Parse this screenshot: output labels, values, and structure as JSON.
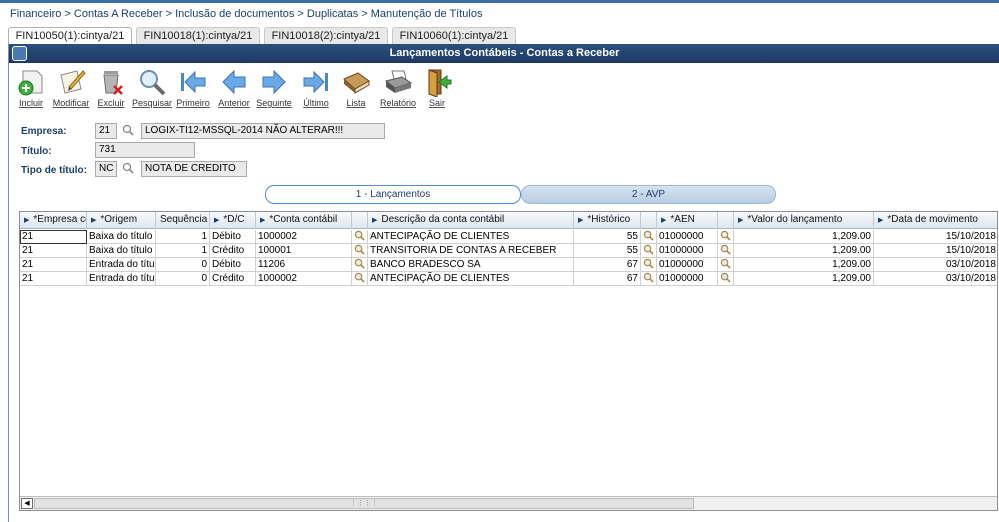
{
  "breadcrumb": "Financeiro > Contas A Receber > Inclusão de documentos > Duplicatas > Manutenção de Títulos",
  "tabs": [
    {
      "label": "FIN10050(1):cintya/21",
      "active": true
    },
    {
      "label": "FIN10018(1):cintya/21",
      "active": false
    },
    {
      "label": "FIN10018(2):cintya/21",
      "active": false
    },
    {
      "label": "FIN10060(1):cintya/21",
      "active": false
    }
  ],
  "window": {
    "title": "Lançamentos Contábeis - Contas a Receber"
  },
  "toolbar": {
    "incluir": "Incluir",
    "modificar": "Modificar",
    "excluir": "Excluir",
    "pesquisar": "Pesquisar",
    "primeiro": "Primeiro",
    "anterior": "Anterior",
    "seguinte": "Seguinte",
    "ultimo": "Último",
    "lista": "Lista",
    "relatorio": "Relatório",
    "sair": "Sair"
  },
  "form": {
    "empresa": {
      "label": "Empresa:",
      "code": "21",
      "description": "LOGIX-TI12-MSSQL-2014 NÃO ALTERAR!!!"
    },
    "titulo": {
      "label": "Título:",
      "value": "731"
    },
    "tipo_titulo": {
      "label": "Tipo de título:",
      "code": "NC",
      "description": "NOTA DE CREDITO"
    }
  },
  "subtabs": [
    {
      "label": "1 - Lançamentos",
      "active": true
    },
    {
      "label": "2 - AVP",
      "active": false
    }
  ],
  "grid": {
    "columns": [
      "*Empresa con",
      "*Origem",
      "Sequência",
      "*D/C",
      "*Conta contábil",
      "",
      "Descrição da conta contábil",
      "*Histórico",
      "",
      "*AEN",
      "",
      "*Valor do lançamento",
      "*Data de movimento"
    ],
    "rows": [
      {
        "empresa": "21",
        "origem": "Baixa do título",
        "sequencia": "1",
        "dc": "Débito",
        "conta": "1000002",
        "descricao": "ANTECIPAÇÃO DE CLIENTES",
        "historico": "55",
        "aen": "01000000",
        "valor": "1,209.00",
        "data": "15/10/2018"
      },
      {
        "empresa": "21",
        "origem": "Baixa do título",
        "sequencia": "1",
        "dc": "Crédito",
        "conta": "100001",
        "descricao": "TRANSITORIA DE CONTAS A RECEBER",
        "historico": "55",
        "aen": "01000000",
        "valor": "1,209.00",
        "data": "15/10/2018"
      },
      {
        "empresa": "21",
        "origem": "Entrada do título",
        "sequencia": "0",
        "dc": "Débito",
        "conta": "11206",
        "descricao": "BANCO BRADESCO SA",
        "historico": "67",
        "aen": "01000000",
        "valor": "1,209.00",
        "data": "03/10/2018"
      },
      {
        "empresa": "21",
        "origem": "Entrada do título",
        "sequencia": "0",
        "dc": "Crédito",
        "conta": "1000002",
        "descricao": "ANTECIPAÇÃO DE CLIENTES",
        "historico": "67",
        "aen": "01000000",
        "valor": "1,209.00",
        "data": "03/10/2018"
      }
    ]
  },
  "colors": {
    "titlebar": "#1c3a63",
    "accent": "#4f8fd0",
    "label": "#1b3f6b"
  }
}
